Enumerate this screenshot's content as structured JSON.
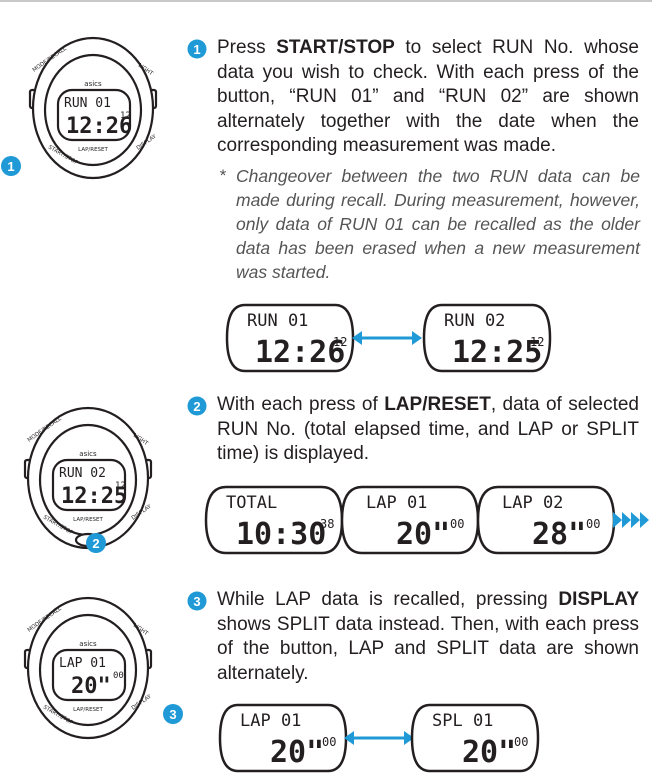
{
  "accent": "#1f9ad6",
  "steps": [
    {
      "number": "1",
      "pre": "Press ",
      "bold1": "START",
      "slash1": "/",
      "bold2": "STOP",
      "post": " to select RUN No. whose data you wish to check. With each press of the button, “RUN 01” and “RUN 02” are shown alternately together with the date when the corresponding measurement was made.",
      "note_mark": "*",
      "note": "Changeover between the two RUN data can be made during recall.  During measurement, however, only data of RUN 01 can be recalled as the older data has been erased when a new measurement was started."
    },
    {
      "number": "2",
      "pre": "With each press of ",
      "bold1": "LAP",
      "slash1": "/",
      "bold2": "RESET",
      "post": ", data of selected RUN No. (total elapsed time, and LAP or SPLIT time) is displayed."
    },
    {
      "number": "3",
      "pre": "While LAP data is recalled, pressing ",
      "bold1": "DISPLAY",
      "post": " shows SPLIT data instead.  Then, with each press of the button, LAP and SPLIT data are shown alternately."
    }
  ],
  "watch": {
    "brand": "asics",
    "btn_upper_left": "MODE/RECALL",
    "btn_upper_right": "LIGHT",
    "btn_lower_left": "START/STOP",
    "btn_lower_right": "DISPLAY",
    "btn_bottom": "LAP/RESET",
    "w1": {
      "top": "RUN 01",
      "main": "12:26",
      "small": "12"
    },
    "w2": {
      "top": "RUN 02",
      "main": "12:25",
      "small": "12"
    },
    "w3": {
      "top": "LAP 01",
      "main": "20\"",
      "small": "00"
    }
  },
  "displays": {
    "d1a": {
      "top": "RUN 01",
      "main": "12:26",
      "small": "12"
    },
    "d1b": {
      "top": "RUN 02",
      "main": "12:25",
      "small": "12"
    },
    "d2a": {
      "top": "TOTAL",
      "main": "10:30",
      "small": "38"
    },
    "d2b": {
      "top": "LAP 01",
      "main": "20\"",
      "small": "00"
    },
    "d2c": {
      "top": "LAP 02",
      "main": "28\"",
      "small": "00"
    },
    "d3a": {
      "top": "LAP 01",
      "main": "20\"",
      "small": "00"
    },
    "d3b": {
      "top": "SPL 01",
      "main": "20\"",
      "small": "00"
    }
  }
}
